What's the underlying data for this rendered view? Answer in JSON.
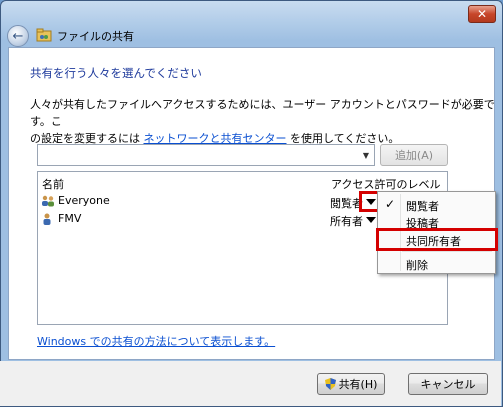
{
  "window": {
    "title": "ファイルの共有",
    "close_label": "✕"
  },
  "heading": "共有を行う人々を選んでください",
  "description": {
    "line1": "人々が共有したファイルへアクセスするためには、ユーザー アカウントとパスワードが必要です。こ",
    "line2_prefix": "の設定を変更するには ",
    "line2_link": "ネットワークと共有センター",
    "line2_suffix": " を使用してください。"
  },
  "combo": {
    "value": "",
    "arrow": "▼"
  },
  "add_button": "追加(A)",
  "list": {
    "col_name": "名前",
    "col_perm": "アクセス許可のレベル",
    "rows": [
      {
        "name": "Everyone",
        "perm": "閲覧者",
        "icon": "group-icon"
      },
      {
        "name": "FMV",
        "perm": "所有者",
        "icon": "user-icon"
      }
    ]
  },
  "menu": {
    "check": "✓",
    "items": [
      "閲覧者",
      "投稿者",
      "共同所有者",
      "削除"
    ]
  },
  "help_link": "Windows での共有の方法について表示します。",
  "buttons": {
    "share": "共有(H)",
    "cancel": "キャンセル"
  },
  "colors": {
    "highlight_red": "#d40000",
    "link_blue": "#0a4fd1",
    "heading_blue": "#1e3a9c"
  }
}
